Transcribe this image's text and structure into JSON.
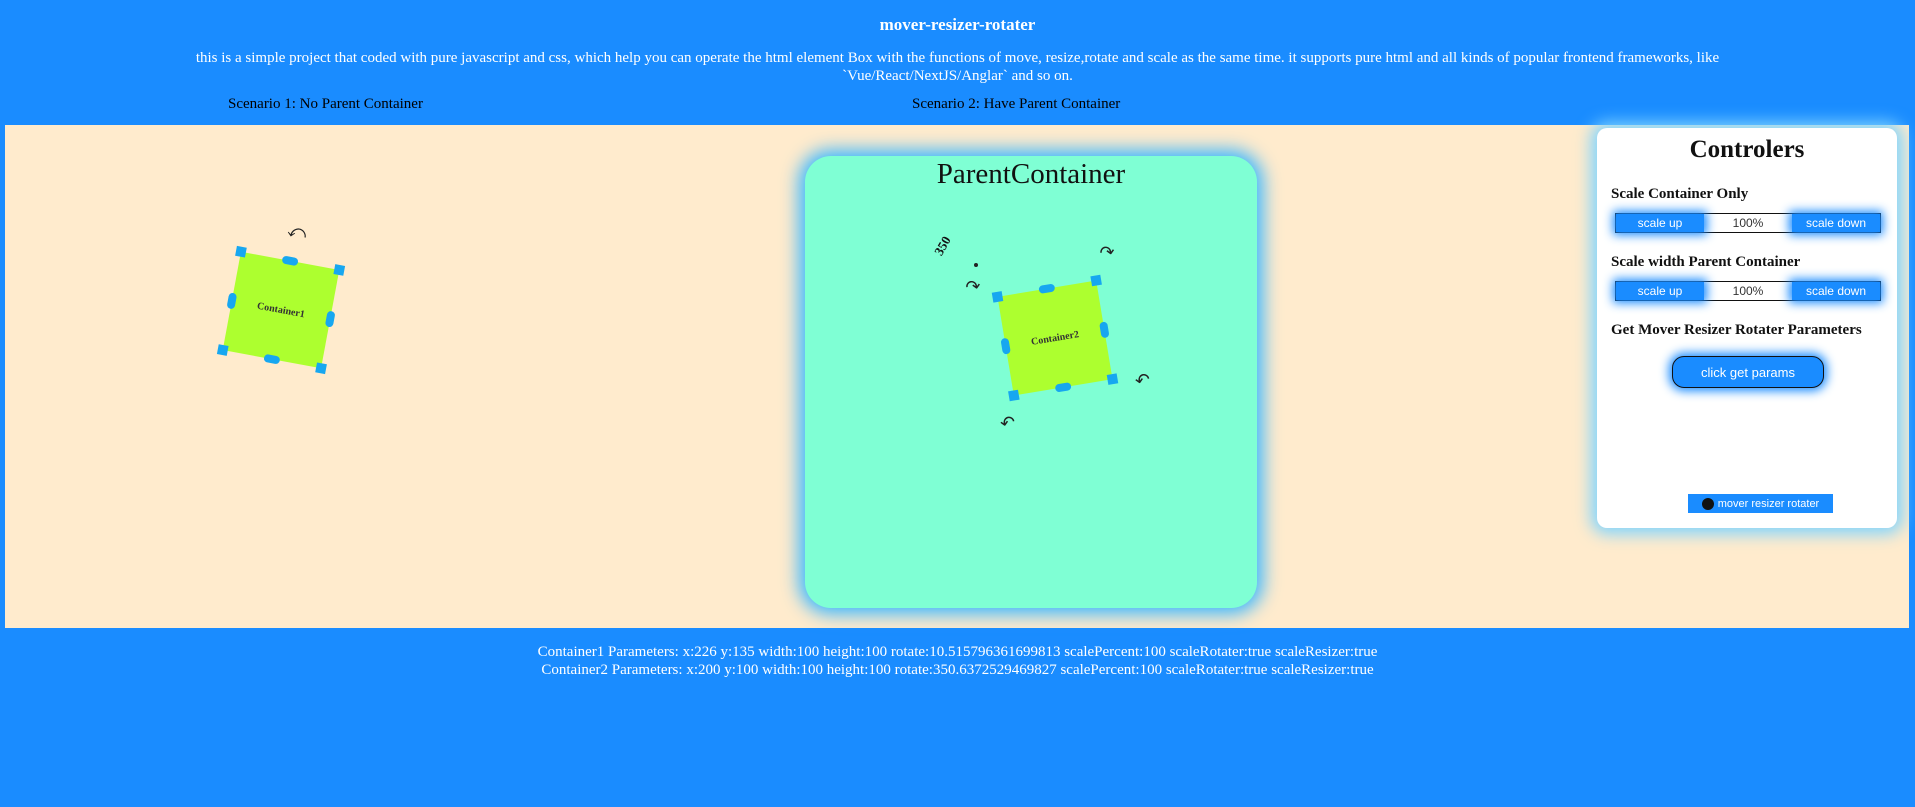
{
  "header": {
    "title": "mover-resizer-rotater",
    "description": "this is a simple project that coded with pure javascript and css, which help you can operate the html element Box with the functions of move, resize,rotate and scale as the same time. it supports pure html and all kinds of popular frontend frameworks, like `Vue/React/NextJS/Anglar` and so on.",
    "scenario1": "Scenario 1: No Parent Container",
    "scenario2": "Scenario 2: Have Parent Container"
  },
  "stage": {
    "container1_label": "Container1",
    "parent_title": "ParentContainer",
    "container2_label": "Container2",
    "rotation_readout": "350"
  },
  "controls": {
    "title": "Controlers",
    "scale_container_label": "Scale Container Only",
    "scale_parent_label": "Scale width Parent Container",
    "scale_up": "scale up",
    "scale_down": "scale down",
    "scale_container_value": "100%",
    "scale_parent_value": "100%",
    "get_params_label": "Get Mover Resizer Rotater Parameters",
    "get_params_button": "click get params",
    "github_link": "mover resizer rotater"
  },
  "footer": {
    "container1_params": "Container1 Parameters: x:226 y:135 width:100 height:100 rotate:10.515796361699813 scalePercent:100 scaleRotater:true scaleResizer:true",
    "container2_params": "Container2 Parameters: x:200 y:100 width:100 height:100 rotate:350.6372529469827 scalePercent:100 scaleRotater:true scaleResizer:true"
  },
  "icons": {
    "rotate": "rotate-arrow-icon",
    "github": "github-icon"
  },
  "colors": {
    "background": "#1a8cff",
    "stage": "#ffebcd",
    "box": "#adff2f",
    "parent": "#7fffd4",
    "handle": "#17a7f0"
  }
}
